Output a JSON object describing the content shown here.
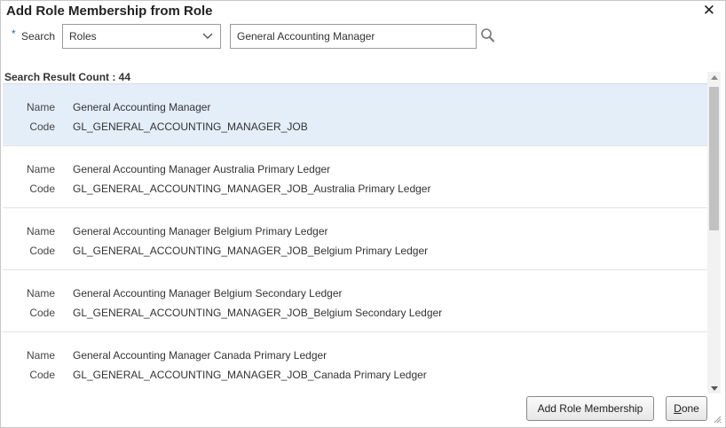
{
  "dialog": {
    "title": "Add Role Membership from Role",
    "close_glyph": "✕"
  },
  "search": {
    "required_marker": "*",
    "label": "Search",
    "type_value": "Roles",
    "query_value": "General Accounting Manager"
  },
  "results": {
    "count_text": "Search Result Count : 44",
    "name_label": "Name",
    "code_label": "Code",
    "items": [
      {
        "name": "General Accounting Manager",
        "code": "GL_GENERAL_ACCOUNTING_MANAGER_JOB",
        "selected": true
      },
      {
        "name": "General Accounting Manager Australia Primary Ledger",
        "code": "GL_GENERAL_ACCOUNTING_MANAGER_JOB_Australia Primary Ledger",
        "selected": false
      },
      {
        "name": "General Accounting Manager Belgium Primary Ledger",
        "code": "GL_GENERAL_ACCOUNTING_MANAGER_JOB_Belgium Primary Ledger",
        "selected": false
      },
      {
        "name": "General Accounting Manager Belgium Secondary Ledger",
        "code": "GL_GENERAL_ACCOUNTING_MANAGER_JOB_Belgium Secondary Ledger",
        "selected": false
      },
      {
        "name": "General Accounting Manager Canada Primary Ledger",
        "code": "GL_GENERAL_ACCOUNTING_MANAGER_JOB_Canada Primary Ledger",
        "selected": false
      }
    ]
  },
  "buttons": {
    "add_label": "Add Role Membership",
    "done_first": "D",
    "done_rest": "one"
  },
  "icons": {
    "close": "close-icon",
    "dropdown": "chevron-down-icon",
    "search": "magnifier-icon",
    "resize": "resize-grip-icon"
  },
  "colors": {
    "selected_row": "#e3eef9",
    "required_marker": "#1f6fb5"
  }
}
